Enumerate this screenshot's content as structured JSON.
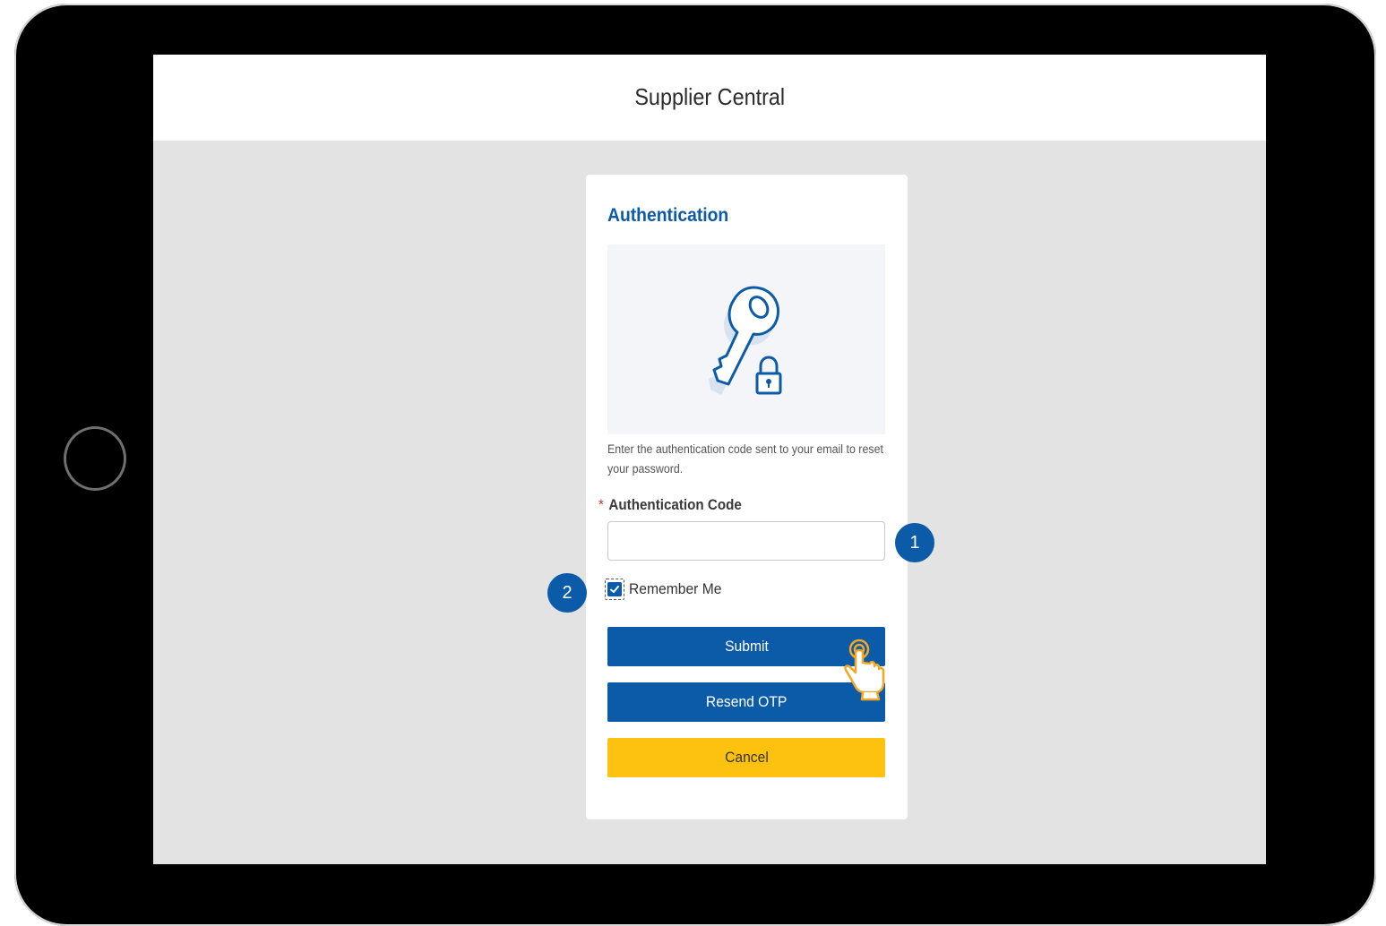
{
  "header": {
    "app_title": "Supplier Central"
  },
  "auth_card": {
    "title": "Authentication",
    "illustration_icon": "key-lock-icon",
    "description": "Enter the authentication code sent to your email to reset your password.",
    "code_field": {
      "required_marker": "*",
      "label": "Authentication Code",
      "value": "",
      "placeholder": ""
    },
    "remember_me": {
      "label": "Remember Me",
      "checked": true
    },
    "buttons": {
      "submit": "Submit",
      "resend": "Resend OTP",
      "cancel": "Cancel"
    }
  },
  "callouts": {
    "one": "1",
    "two": "2"
  },
  "colors": {
    "primary_blue": "#0b5ba8",
    "cancel_yellow": "#fdc20f",
    "screen_bg": "#e3e3e3",
    "cursor_orange": "#f5a623"
  }
}
